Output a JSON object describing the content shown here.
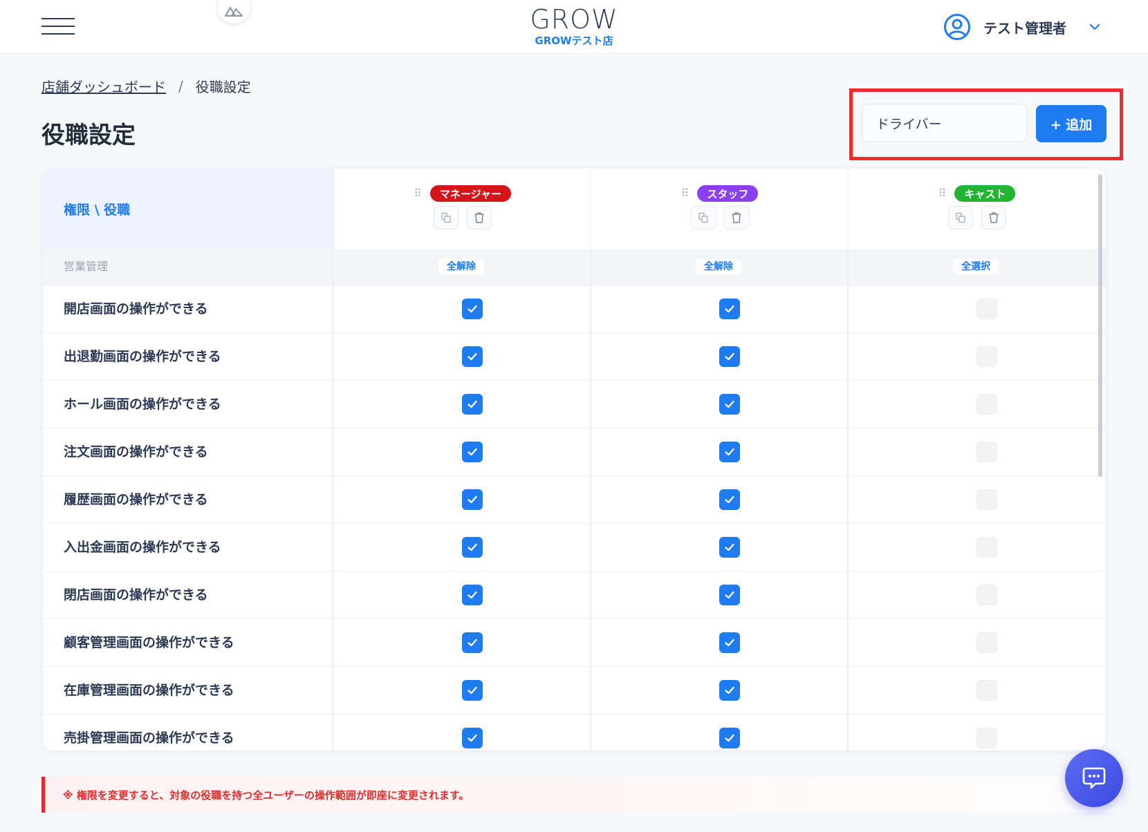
{
  "header": {
    "brand_logo": "GROW",
    "store_name": "GROWテスト店",
    "user_name": "テスト管理者"
  },
  "breadcrumb": {
    "parent": "店舗ダッシュボード",
    "separator": "/",
    "current": "役職設定"
  },
  "page_title": "役職設定",
  "add_role": {
    "input_value": "ドライバー",
    "button_label": "+ 追加"
  },
  "table": {
    "corner_label": "権限 \\ 役職",
    "roles": [
      {
        "name": "マネージャー",
        "color": "#d6151b",
        "section_toggle": "全解除"
      },
      {
        "name": "スタッフ",
        "color": "#8a3ff0",
        "section_toggle": "全解除"
      },
      {
        "name": "キャスト",
        "color": "#21b533",
        "section_toggle": "全選択"
      }
    ],
    "section_label": "営業管理",
    "permissions": [
      {
        "label": "開店画面の操作ができる",
        "values": [
          true,
          true,
          false
        ]
      },
      {
        "label": "出退勤画面の操作ができる",
        "values": [
          true,
          true,
          false
        ]
      },
      {
        "label": "ホール画面の操作ができる",
        "values": [
          true,
          true,
          false
        ]
      },
      {
        "label": "注文画面の操作ができる",
        "values": [
          true,
          true,
          false
        ]
      },
      {
        "label": "履歴画面の操作ができる",
        "values": [
          true,
          true,
          false
        ]
      },
      {
        "label": "入出金画面の操作ができる",
        "values": [
          true,
          true,
          false
        ]
      },
      {
        "label": "閉店画面の操作ができる",
        "values": [
          true,
          true,
          false
        ]
      },
      {
        "label": "顧客管理画面の操作ができる",
        "values": [
          true,
          true,
          false
        ]
      },
      {
        "label": "在庫管理画面の操作ができる",
        "values": [
          true,
          true,
          false
        ]
      },
      {
        "label": "売掛管理画面の操作ができる",
        "values": [
          true,
          true,
          false
        ]
      }
    ]
  },
  "notice": "※ 権限を変更すると、対象の役職を持つ全ユーザーの操作範囲が即座に変更されます。",
  "colors": {
    "accent": "#1e7cf0",
    "highlight_border": "#ef2b2b",
    "warning": "#e12c2c"
  }
}
